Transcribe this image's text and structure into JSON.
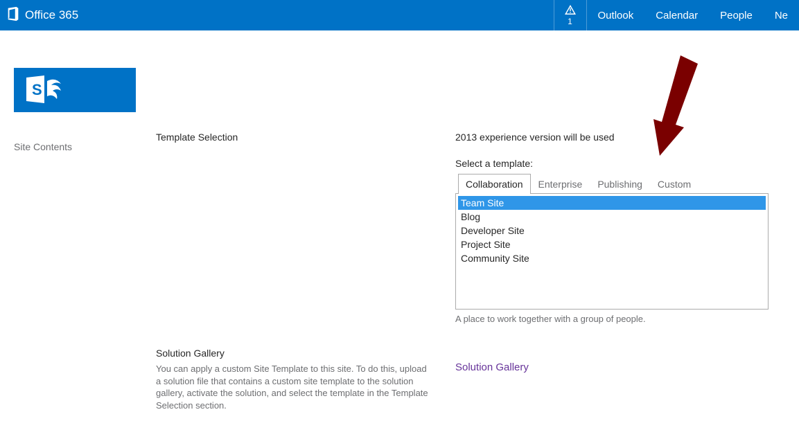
{
  "brand": "Office 365",
  "notifications": {
    "count": "1"
  },
  "topnav": {
    "items": [
      {
        "label": "Outlook"
      },
      {
        "label": "Calendar"
      },
      {
        "label": "People"
      },
      {
        "label": "Ne"
      }
    ]
  },
  "sidebar": {
    "site_contents": "Site Contents"
  },
  "template_section": {
    "heading": "Template Selection",
    "version_text": "2013 experience version will be used",
    "select_label": "Select a template:",
    "tabs": [
      {
        "label": "Collaboration"
      },
      {
        "label": "Enterprise"
      },
      {
        "label": "Publishing"
      },
      {
        "label": "Custom"
      }
    ],
    "options": [
      {
        "label": "Team Site"
      },
      {
        "label": "Blog"
      },
      {
        "label": "Developer Site"
      },
      {
        "label": "Project Site"
      },
      {
        "label": "Community Site"
      }
    ],
    "selected_description": "A place to work together with a group of people."
  },
  "solution_section": {
    "heading": "Solution Gallery",
    "helptext": "You can apply a custom Site Template to this site. To do this, upload a solution file that contains a custom site template to the solution gallery, activate the solution, and select the template in the Template Selection section.",
    "link_label": "Solution Gallery"
  },
  "colors": {
    "brand_blue": "#0072C6",
    "arrow": "#8B0000"
  }
}
